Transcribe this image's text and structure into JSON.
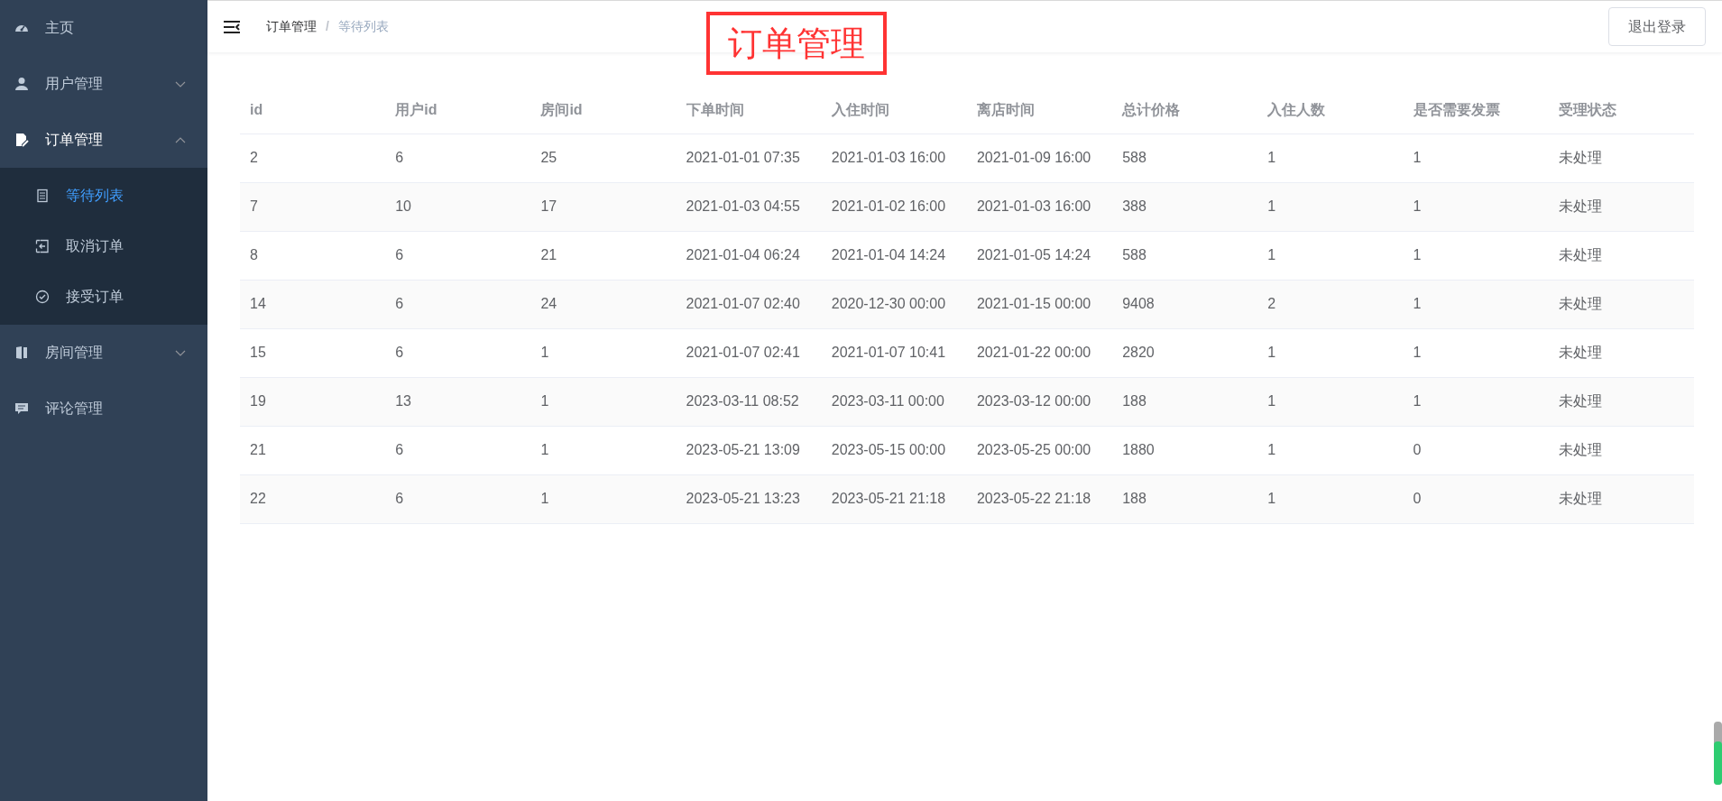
{
  "sidebar": {
    "items": [
      {
        "label": "主页"
      },
      {
        "label": "用户管理",
        "expanded": false
      },
      {
        "label": "订单管理",
        "expanded": true,
        "children": [
          {
            "label": "等待列表",
            "selected": true
          },
          {
            "label": "取消订单",
            "selected": false
          },
          {
            "label": "接受订单",
            "selected": false
          }
        ]
      },
      {
        "label": "房间管理",
        "expanded": false
      },
      {
        "label": "评论管理"
      }
    ]
  },
  "header": {
    "breadcrumb": [
      "订单管理",
      "等待列表"
    ],
    "breadcrumb_separator": "/",
    "annotation": "订单管理",
    "logout_button": "退出登录"
  },
  "table": {
    "columns": [
      "id",
      "用户id",
      "房间id",
      "下单时间",
      "入住时间",
      "离店时间",
      "总计价格",
      "入住人数",
      "是否需要发票",
      "受理状态"
    ],
    "rows": [
      [
        "2",
        "6",
        "25",
        "2021-01-01 07:35",
        "2021-01-03 16:00",
        "2021-01-09 16:00",
        "588",
        "1",
        "1",
        "未处理"
      ],
      [
        "7",
        "10",
        "17",
        "2021-01-03 04:55",
        "2021-01-02 16:00",
        "2021-01-03 16:00",
        "388",
        "1",
        "1",
        "未处理"
      ],
      [
        "8",
        "6",
        "21",
        "2021-01-04 06:24",
        "2021-01-04 14:24",
        "2021-01-05 14:24",
        "588",
        "1",
        "1",
        "未处理"
      ],
      [
        "14",
        "6",
        "24",
        "2021-01-07 02:40",
        "2020-12-30 00:00",
        "2021-01-15 00:00",
        "9408",
        "2",
        "1",
        "未处理"
      ],
      [
        "15",
        "6",
        "1",
        "2021-01-07 02:41",
        "2021-01-07 10:41",
        "2021-01-22 00:00",
        "2820",
        "1",
        "1",
        "未处理"
      ],
      [
        "19",
        "13",
        "1",
        "2023-03-11 08:52",
        "2023-03-11 00:00",
        "2023-03-12 00:00",
        "188",
        "1",
        "1",
        "未处理"
      ],
      [
        "21",
        "6",
        "1",
        "2023-05-21 13:09",
        "2023-05-15 00:00",
        "2023-05-25 00:00",
        "1880",
        "1",
        "0",
        "未处理"
      ],
      [
        "22",
        "6",
        "1",
        "2023-05-21 13:23",
        "2023-05-21 21:18",
        "2023-05-22 21:18",
        "188",
        "1",
        "0",
        "未处理"
      ]
    ]
  }
}
